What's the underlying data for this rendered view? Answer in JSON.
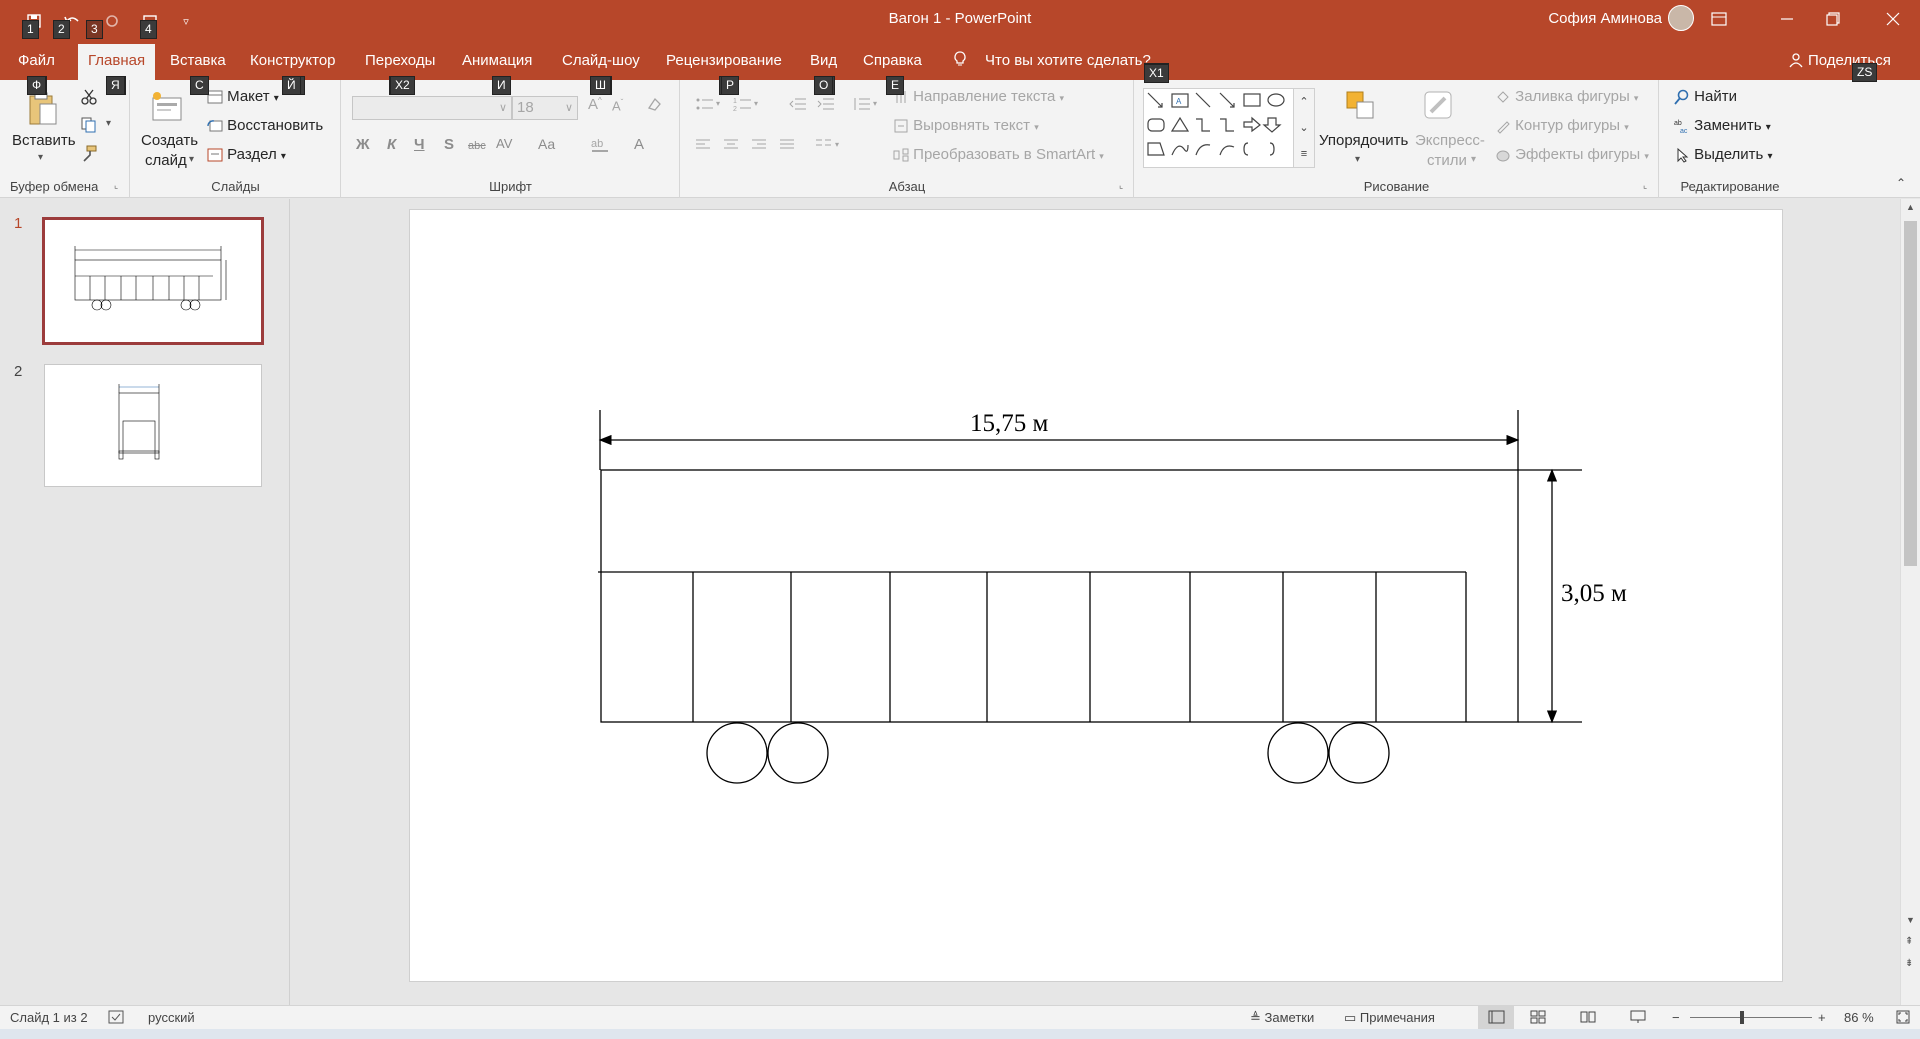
{
  "window": {
    "doc_title": "Вагон 1  -  PowerPoint",
    "user_name": "София Аминова"
  },
  "quick_access": {
    "keytips": [
      "1",
      "2",
      "3",
      "4"
    ]
  },
  "tabs": [
    {
      "label": "Файл",
      "keytip": "Ф"
    },
    {
      "label": "Главная",
      "keytip": "Я"
    },
    {
      "label": "Вставка",
      "keytip": "С"
    },
    {
      "label": "Конструктор",
      "keytip": "Й"
    },
    {
      "label": "Переходы",
      "keytip": "Х2"
    },
    {
      "label": "Анимация",
      "keytip": "И"
    },
    {
      "label": "Слайд-шоу",
      "keytip": "Ш"
    },
    {
      "label": "Рецензирование",
      "keytip": "Р"
    },
    {
      "label": "Вид",
      "keytip": "О"
    },
    {
      "label": "Справка",
      "keytip": "Е"
    }
  ],
  "tell_me": {
    "label": "Что вы хотите сделать?",
    "keytip": "Х1"
  },
  "share": {
    "label": "Поделиться",
    "keytip": "ZS"
  },
  "ribbon": {
    "clipboard": {
      "paste": "Вставить",
      "group": "Буфер обмена"
    },
    "slides": {
      "new_slide_line1": "Создать",
      "new_slide_line2": "слайд",
      "layout": "Макет",
      "reset": "Восстановить",
      "section": "Раздел",
      "group": "Слайды"
    },
    "font": {
      "size": "18",
      "bold": "Ж",
      "italic": "К",
      "underline": "Ч",
      "strike": "S",
      "abc": "abc",
      "spacing": "AV",
      "case": "Aa",
      "color": "A",
      "group": "Шрифт"
    },
    "paragraph": {
      "text_direction": "Направление текста",
      "align_text": "Выровнять текст",
      "smartart": "Преобразовать в SmartArt",
      "group": "Абзац"
    },
    "drawing": {
      "arrange": "Упорядочить",
      "quick_styles_line1": "Экспресс-",
      "quick_styles_line2": "стили",
      "fill": "Заливка фигуры",
      "outline": "Контур фигуры",
      "effects": "Эффекты фигуры",
      "group": "Рисование"
    },
    "editing": {
      "find": "Найти",
      "replace": "Заменить",
      "select": "Выделить",
      "group": "Редактирование"
    }
  },
  "thumbnails": [
    {
      "number": "1",
      "selected": true
    },
    {
      "number": "2",
      "selected": false
    }
  ],
  "slide": {
    "length_label": "15,75 м",
    "height_label": "3,05 м"
  },
  "status": {
    "slide_info": "Слайд 1 из 2",
    "language": "русский",
    "notes": "Заметки",
    "comments": "Примечания",
    "zoom": "86 %"
  }
}
